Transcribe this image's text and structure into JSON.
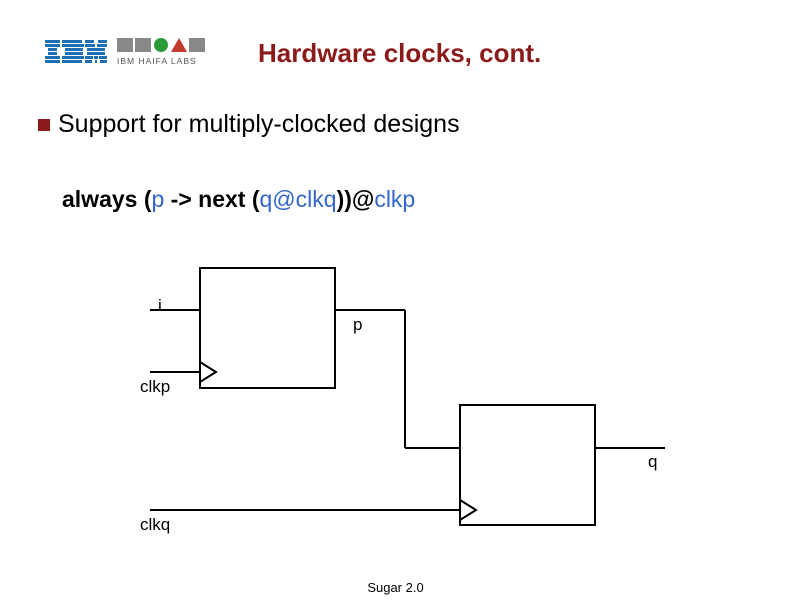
{
  "header": {
    "title": "Hardware clocks, cont.",
    "logo_ibm": "IBM",
    "logo_haifa": "IBM HAIFA LABS"
  },
  "bullet": {
    "text": "Support for multiply-clocked designs"
  },
  "code": {
    "kw_always": "always (",
    "p": "p",
    "arrow_next": " -> next (",
    "q_at": "q@",
    "clkq": "clkq",
    "close_at": "))@",
    "clkp": "clkp"
  },
  "diagram": {
    "labels": {
      "i": "i",
      "p": "p",
      "clkp": "clkp",
      "q": "q",
      "clkq": "clkq"
    }
  },
  "footer": "Sugar 2.0"
}
